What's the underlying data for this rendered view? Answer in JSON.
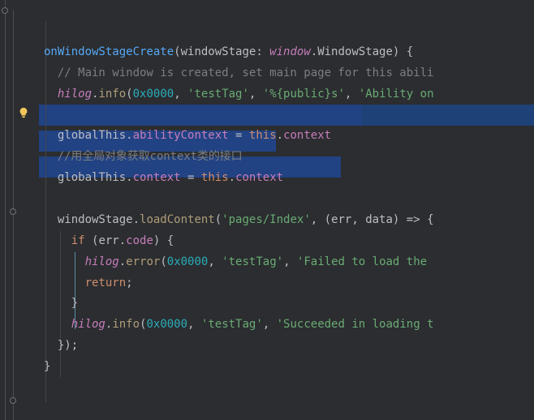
{
  "lines": {
    "l1_fn": "onWindowStageCreate",
    "l1_p1": "(",
    "l1_arg": "windowStage",
    "l1_colon": ": ",
    "l1_ns": "window",
    "l1_dot": ".",
    "l1_type": "WindowStage",
    "l1_p2": ") {",
    "l2": "// Main window is created, set main page for this abili",
    "l3_a": "hilog",
    "l3_b": ".",
    "l3_c": "info",
    "l3_d": "(",
    "l3_e": "0x0000",
    "l3_f": ", ",
    "l3_g": "'testTag'",
    "l3_h": ", ",
    "l3_i": "'%{public}s'",
    "l3_j": ", ",
    "l3_k": "'Ability on",
    "l5_a": "globalThis",
    "l5_b": ".",
    "l5_c": "abilityContext",
    "l5_d": " = ",
    "l5_e": "this",
    "l5_f": ".",
    "l5_g": "context",
    "l6": "//用全局对象获取context类的接口",
    "l7_a": "globalThis",
    "l7_b": ".",
    "l7_c": "context",
    "l7_d": " = ",
    "l7_e": "this",
    "l7_f": ".",
    "l7_g": "context",
    "l9_a": "windowStage",
    "l9_b": ".",
    "l9_c": "loadContent",
    "l9_d": "(",
    "l9_e": "'pages/Index'",
    "l9_f": ", (",
    "l9_g": "err",
    "l9_h": ", ",
    "l9_i": "data",
    "l9_j": ") => {",
    "l10_a": "if",
    "l10_b": " (",
    "l10_c": "err",
    "l10_d": ".",
    "l10_e": "code",
    "l10_f": ") {",
    "l11_a": "hilog",
    "l11_b": ".",
    "l11_c": "error",
    "l11_d": "(",
    "l11_e": "0x0000",
    "l11_f": ", ",
    "l11_g": "'testTag'",
    "l11_h": ", ",
    "l11_i": "'Failed to load the ",
    "l12_a": "return",
    "l12_b": ";",
    "l13": "}",
    "l14_a": "hilog",
    "l14_b": ".",
    "l14_c": "info",
    "l14_d": "(",
    "l14_e": "0x0000",
    "l14_f": ", ",
    "l14_g": "'testTag'",
    "l14_h": ", ",
    "l14_i": "'Succeeded in loading t",
    "l15": "});",
    "l16": "}"
  }
}
